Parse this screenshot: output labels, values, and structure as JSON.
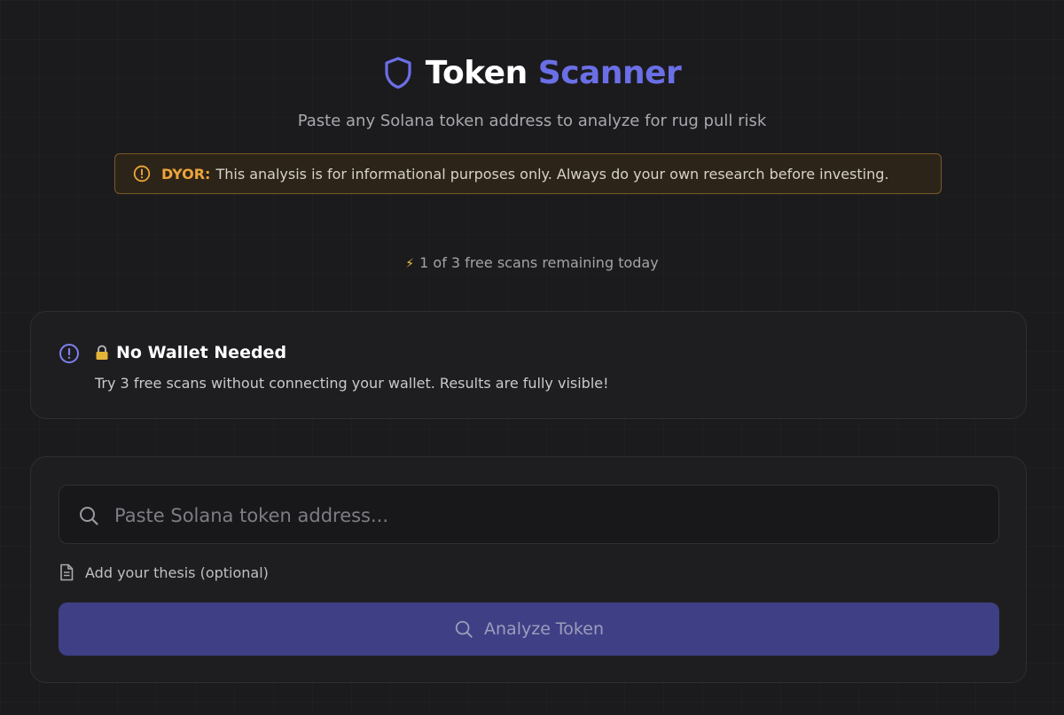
{
  "header": {
    "title_part1": "Token",
    "title_part2": "Scanner",
    "subtitle": "Paste any Solana token address to analyze for rug pull risk",
    "icon": "shield-icon"
  },
  "disclaimer": {
    "label": "DYOR:",
    "text": "This analysis is for informational purposes only. Always do your own research before investing.",
    "icon": "alert-circle-icon"
  },
  "quota": {
    "icon": "lightning-bolt",
    "bolt_glyph": "⚡",
    "text": "1 of 3 free scans remaining today",
    "used": 1,
    "total": 3
  },
  "info_card": {
    "icon": "info-circle-icon",
    "title_icon": "lock-icon",
    "title": "No Wallet Needed",
    "text": "Try 3 free scans without connecting your wallet. Results are fully visible!"
  },
  "scan_form": {
    "input_placeholder": "Paste Solana token address...",
    "input_value": "",
    "thesis_label": "Add your thesis (optional)",
    "button_label": "Analyze Token"
  },
  "colors": {
    "accent": "#6b6fe6",
    "warning": "#eda43a",
    "background": "#1b1b1e",
    "button": "#3f3f85"
  }
}
